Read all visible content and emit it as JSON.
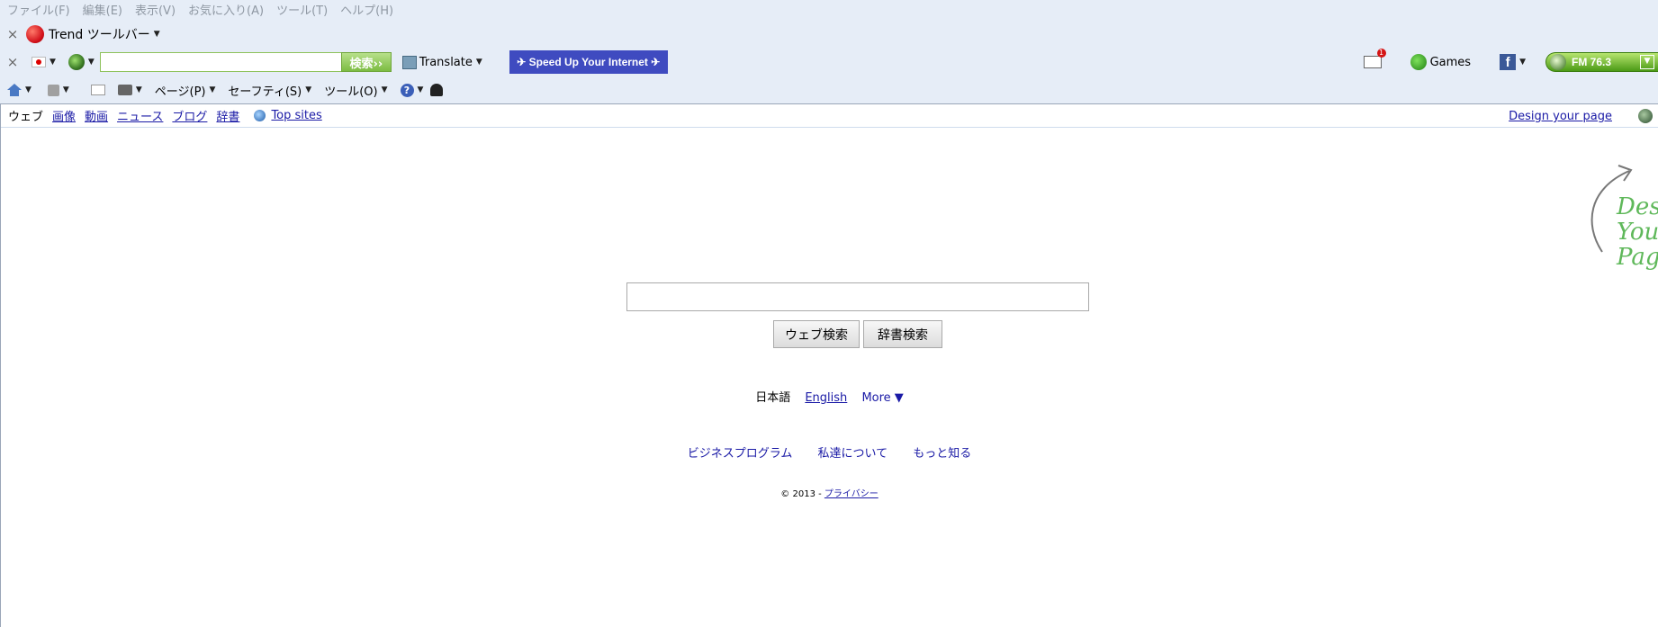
{
  "menubar": [
    "ファイル(F)",
    "編集(E)",
    "表示(V)",
    "お気に入り(A)",
    "ツール(T)",
    "ヘルプ(H)"
  ],
  "trend_toolbar": {
    "title": "Trend ツールバー"
  },
  "toolbar2": {
    "search_value": "",
    "search_button": "検索››",
    "translate_label": "Translate",
    "speed_label": "✈ Speed Up Your Internet ✈",
    "mail_badge": "1",
    "games_label": "Games",
    "facebook_glyph": "f",
    "radio_station": "FM 76.3"
  },
  "commandbar": {
    "page_label": "ページ(P)",
    "safety_label": "セーフティ(S)",
    "tools_label": "ツール(O)",
    "help_glyph": "?"
  },
  "topnav": {
    "active": "ウェブ",
    "links": [
      "画像",
      "動画",
      "ニュース",
      "ブログ",
      "辞書"
    ],
    "topsites": "Top sites",
    "design": "Design your page"
  },
  "design_art": {
    "line1": "Desig",
    "line2": "Your",
    "line3": "Page"
  },
  "search": {
    "value": "",
    "web_button": "ウェブ検索",
    "dict_button": "辞書検索"
  },
  "languages": {
    "current": "日本語",
    "english": "English",
    "more": "More ▼"
  },
  "footer": {
    "links": [
      "ビジネスプログラム",
      "私達について",
      "もっと知る"
    ],
    "copyright": "© 2013 - ",
    "privacy": "プライバシー"
  },
  "colors": {
    "chrome_bg": "#e6edf7",
    "link": "#1a1aa6",
    "speed_bg": "#3f4bc0",
    "trend_green": "#7cbc42"
  }
}
